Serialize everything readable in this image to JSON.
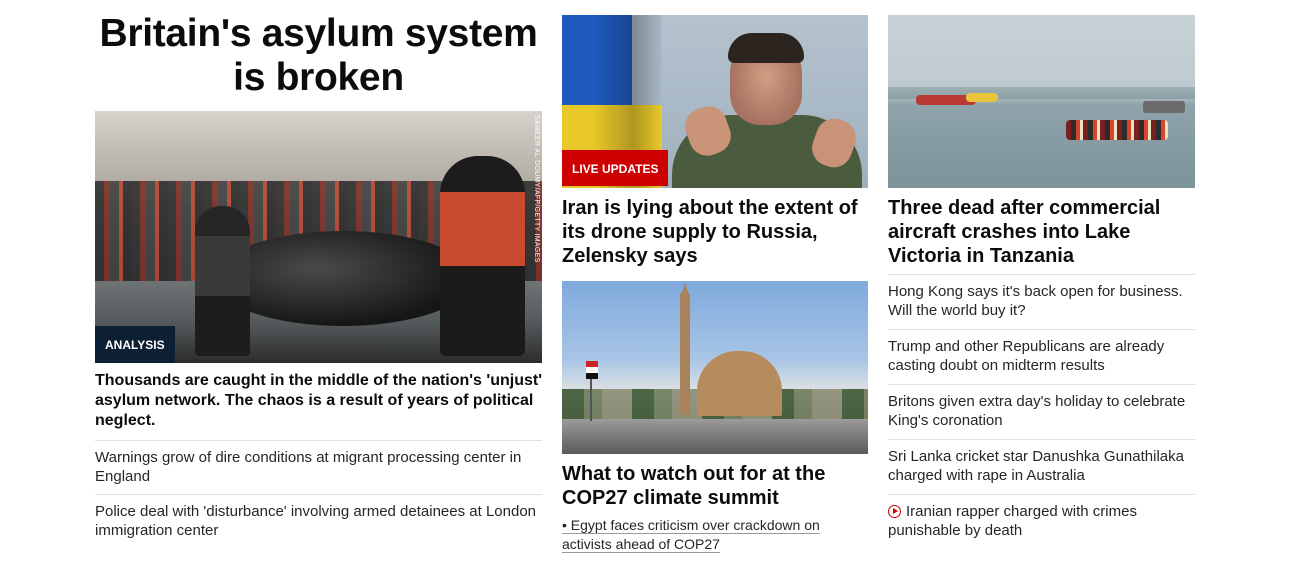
{
  "col1": {
    "headline": "Britain's asylum system is broken",
    "image_credit": "SAMEER AL-DOUMY/AFP/GETTY IMAGES",
    "badge": "ANALYSIS",
    "lede": "Thousands are caught in the middle of the nation's 'unjust' asylum network. The chaos is a result of years of political neglect.",
    "links": [
      "Warnings grow of dire conditions at migrant processing center in England",
      "Police deal with 'disturbance' involving armed detainees at London immigration center"
    ]
  },
  "col2": {
    "top_badge": "LIVE UPDATES",
    "top_headline": "Iran is lying about the extent of its drone supply to Russia, Zelensky says",
    "bottom_headline": "What to watch out for at the COP27 climate summit",
    "bottom_sublink": "• Egypt faces criticism over crackdown on activists ahead of COP27"
  },
  "col3": {
    "headline": "Three dead after commercial aircraft crashes into Lake Victoria in Tanzania",
    "links": [
      "Hong Kong says it's back open for business. Will the world buy it?",
      "Trump and other Republicans are already casting doubt on midterm results",
      "Britons given extra day's holiday to celebrate King's coronation",
      "Sri Lanka cricket star Danushka Gunathilaka charged with rape in Australia",
      "Iranian rapper charged with crimes punishable by death"
    ],
    "video_icon": "play-icon"
  },
  "colors": {
    "analysis_badge": "#0c1f33",
    "live_badge": "#cc0000",
    "divider": "#e0e0e0"
  }
}
